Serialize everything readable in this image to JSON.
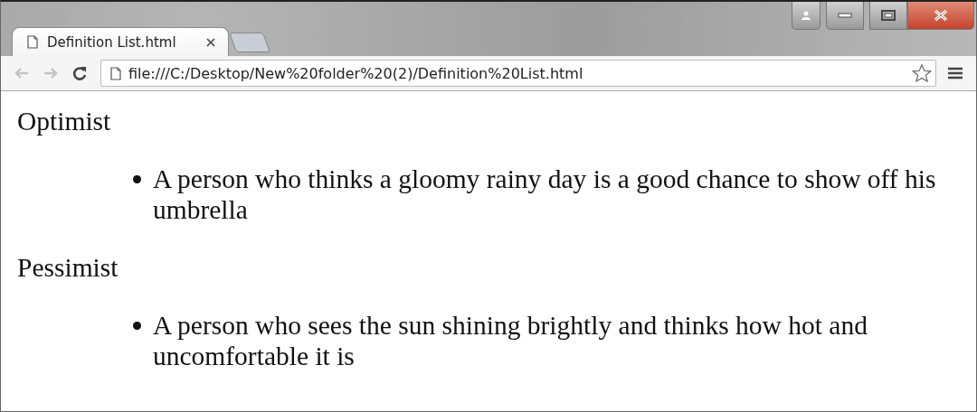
{
  "window": {
    "controls": [
      {
        "kind": "profile"
      },
      {
        "kind": "minimize"
      },
      {
        "kind": "maximize"
      },
      {
        "kind": "close"
      }
    ]
  },
  "tabs": [
    {
      "title": "Definition List.html",
      "selected": true,
      "kind": "page"
    },
    {
      "kind": "new"
    }
  ],
  "toolbar": {
    "back": {
      "disabled": true
    },
    "forward": {
      "disabled": true
    },
    "url": "file:///C:/Desktop/New%20folder%20(2)/Definition%20List.html"
  },
  "definitions": [
    {
      "term": "Optimist",
      "descriptions": [
        "A person who thinks a gloomy rainy day is a good chance to show off his umbrella"
      ]
    },
    {
      "term": "Pessimist",
      "descriptions": [
        "A person who sees the sun shining brightly and thinks how hot and uncomfortable it is"
      ]
    }
  ]
}
